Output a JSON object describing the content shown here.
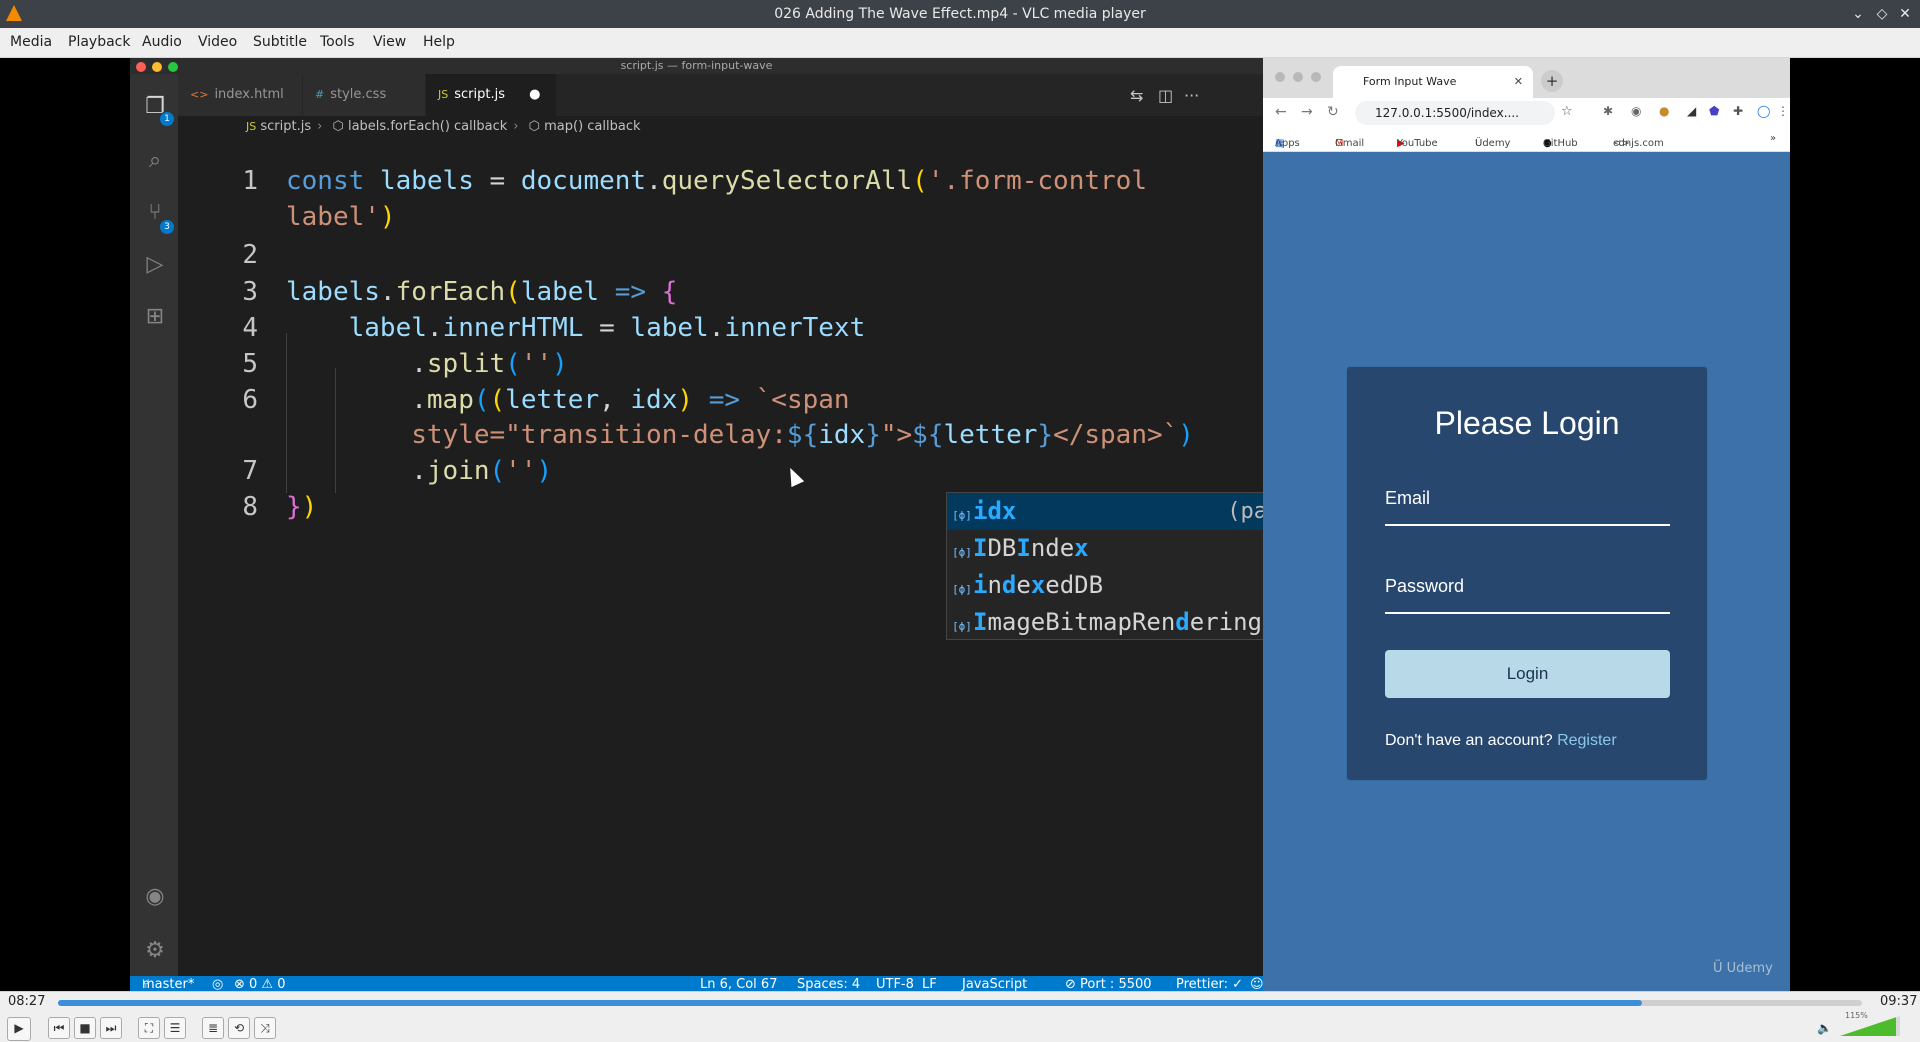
{
  "window": {
    "title": "026 Adding The Wave Effect.mp4 - VLC media player"
  },
  "menu": [
    "Media",
    "Playback",
    "Audio",
    "Video",
    "Subtitle",
    "Tools",
    "View",
    "Help"
  ],
  "vscode": {
    "window_title": "script.js — form-input-wave",
    "tabs": [
      {
        "label": "index.html",
        "glyph": "<>"
      },
      {
        "label": "style.css",
        "glyph": "#"
      },
      {
        "label": "script.js",
        "glyph": "JS",
        "modified": true
      }
    ],
    "breadcrumb": [
      "script.js",
      "labels.forEach() callback",
      "map() callback"
    ],
    "source_control_badge": "3",
    "explorer_badge": "1",
    "code_lines": [
      {
        "n": "1",
        "html": "<span class='kw'>const</span> <span class='var'>labels</span> = <span class='var'>document</span>.<span class='fn'>querySelectorAll</span><span class='br1'>(</span><span class='str'>'.form-control</span>"
      },
      {
        "n": "",
        "html": "<span class='str'>label'</span><span class='br1'>)</span>"
      },
      {
        "n": "2",
        "html": ""
      },
      {
        "n": "3",
        "html": "<span class='var'>labels</span>.<span class='fn'>forEach</span><span class='br1'>(</span><span class='var'>label</span> <span class='kw'>=&gt;</span> <span class='br2'>{</span>"
      },
      {
        "n": "4",
        "html": "    <span class='var'>label</span>.<span class='var'>innerHTML</span> = <span class='var'>label</span>.<span class='var'>innerText</span>"
      },
      {
        "n": "5",
        "html": "        .<span class='fn'>split</span><span class='br3'>(</span><span class='str'>''</span><span class='br3'>)</span>"
      },
      {
        "n": "6",
        "html": "        .<span class='fn'>map</span><span class='br3'>(</span><span class='br1'>(</span><span class='var'>letter</span>, <span class='var'>idx</span><span class='br1'>)</span> <span class='kw'>=&gt;</span> <span class='str'>`&lt;span</span>"
      },
      {
        "n": "",
        "html": "        <span class='str'>style=\"transition-delay:</span><span class='kw'>${</span><span class='var'>idx</span><span class='kw'>}</span><span class='str'>\"&gt;</span><span class='kw'>${</span><span class='var'>letter</span><span class='kw'>}</span><span class='str'>&lt;/span&gt;`</span><span class='br3'>)</span>"
      },
      {
        "n": "7",
        "html": "        .<span class='fn'>join</span><span class='br3'>(</span><span class='str'>''</span><span class='br3'>)</span>"
      },
      {
        "n": "8",
        "html": "<span class='br2'>}</span><span class='br1'>)</span>"
      }
    ],
    "suggestions": [
      {
        "html": "<span class='match'>idx</span>",
        "detail": "(parameter…",
        "selected": true
      },
      {
        "html": "<span class='match'>I</span>DB<span class='match'>I</span>nde<span class='match'>x</span>",
        "detail": "",
        "selected": false
      },
      {
        "html": "<span class='match'>i</span>n<span class='match'>d</span>e<span class='match'>x</span>edDB",
        "detail": "",
        "selected": false
      },
      {
        "html": "<span class='match'>I</span>mageBitmapRen<span class='match'>d</span>eringConte…",
        "detail": "",
        "selected": false
      }
    ],
    "status": {
      "branch": "master*",
      "problems": "⊗ 0 ⚠ 0",
      "cursor_pos": "Ln 6, Col 67",
      "spaces": "Spaces: 4",
      "encoding": "UTF-8",
      "eol": "LF",
      "language": "JavaScript",
      "port": "⊘ Port : 5500",
      "prettier": "Prettier: ✓"
    }
  },
  "browser": {
    "tab_title": "Form Input Wave",
    "url": "127.0.0.1:5500/index....",
    "bookmarks": [
      "Apps",
      "Gmail",
      "YouTube",
      "Udemy",
      "GitHub",
      "cdnjs.com"
    ],
    "form": {
      "title": "Please Login",
      "email_label": "Email",
      "password_label": "Password",
      "login_button": "Login",
      "register_prompt": "Don't have an account?",
      "register_link": "Register"
    },
    "watermark": "Udemy"
  },
  "player": {
    "elapsed": "08:27",
    "total": "09:37",
    "progress": 0.878,
    "volume_label": "115%"
  }
}
